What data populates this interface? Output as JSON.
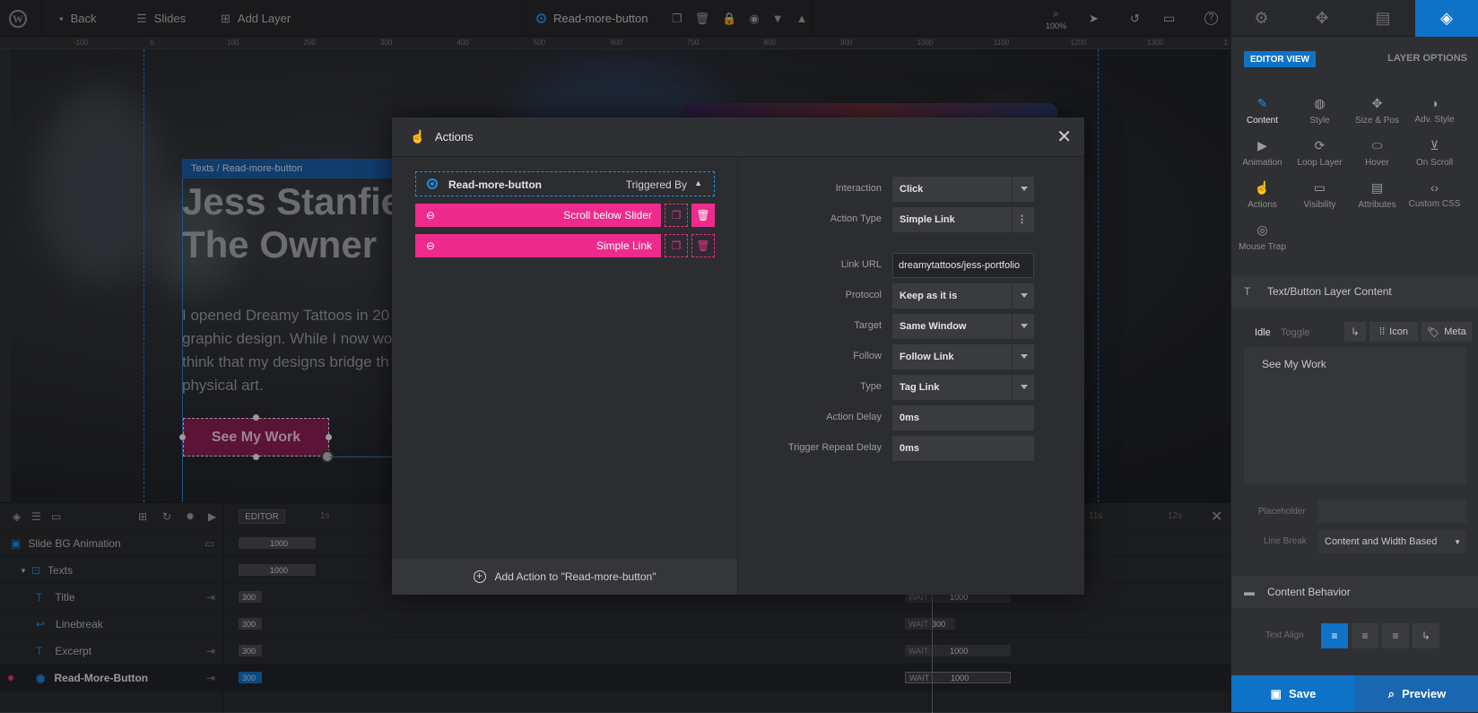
{
  "topbar": {
    "back": "Back",
    "slides": "Slides",
    "add_layer": "Add Layer",
    "layer_name": "Read-more-button",
    "zoom": "100%"
  },
  "ruler": {
    "ticks": [
      "-100",
      "0",
      "100",
      "200",
      "300",
      "400",
      "500",
      "600",
      "700",
      "800",
      "900",
      "1000",
      "1100",
      "1200",
      "1300",
      "1"
    ]
  },
  "canvas": {
    "breadcrumb": "Texts / Read-more-button",
    "title_line1": "Jess Stanfie",
    "title_line2": "The Owner ",
    "excerpt_line1": "I opened Dreamy Tattoos in 20",
    "excerpt_line2": "graphic design. While I now wo",
    "excerpt_line3": "think that my designs bridge th",
    "excerpt_line4": "physical art.",
    "button_label": "See My Work"
  },
  "modal": {
    "title": "Actions",
    "layer_label": "Read-more-button",
    "triggered_by": "Triggered By",
    "actions": [
      {
        "label": "Scroll below Slider"
      },
      {
        "label": "Simple Link"
      }
    ],
    "add_action": "Add Action to \"Read-more-button\"",
    "fields": {
      "interaction": {
        "label": "Interaction",
        "value": "Click"
      },
      "action_type": {
        "label": "Action Type",
        "value": "Simple Link"
      },
      "link_url": {
        "label": "Link URL",
        "value": "dreamytattoos/jess-portfolio"
      },
      "protocol": {
        "label": "Protocol",
        "value": "Keep as it is"
      },
      "target": {
        "label": "Target",
        "value": "Same Window"
      },
      "follow": {
        "label": "Follow",
        "value": "Follow Link"
      },
      "type": {
        "label": "Type",
        "value": "Tag Link"
      },
      "action_delay": {
        "label": "Action Delay",
        "value": "0ms"
      },
      "trigger_repeat_delay": {
        "label": "Trigger Repeat Delay",
        "value": "0ms"
      }
    }
  },
  "timeline": {
    "editor_label": "EDITOR",
    "time_labels": {
      "t1": "1s",
      "t11": "11s",
      "t12": "12s"
    },
    "rows": [
      {
        "name": "Slide BG Animation",
        "bar": "1000"
      },
      {
        "name": "Texts",
        "bar": "1000"
      },
      {
        "name": "Title",
        "bar": "300",
        "wait": "WAIT",
        "end": "1000"
      },
      {
        "name": "Linebreak",
        "bar": "300",
        "wait": "WAIT",
        "end": "300"
      },
      {
        "name": "Excerpt",
        "bar": "300",
        "wait": "WAIT",
        "end": "1000"
      },
      {
        "name": "Read-More-Button",
        "bar": "300",
        "wait": "WAIT",
        "end": "1000"
      }
    ]
  },
  "sidebar": {
    "editor_view": "EDITOR VIEW",
    "layer_options": "LAYER OPTIONS",
    "tools": [
      {
        "label": "Content"
      },
      {
        "label": "Style"
      },
      {
        "label": "Size & Pos"
      },
      {
        "label": "Adv. Style"
      },
      {
        "label": "Animation"
      },
      {
        "label": "Loop Layer"
      },
      {
        "label": "Hover"
      },
      {
        "label": "On Scroll"
      },
      {
        "label": "Actions"
      },
      {
        "label": "Visibility"
      },
      {
        "label": "Attributes"
      },
      {
        "label": "Custom CSS"
      },
      {
        "label": "Mouse Trap"
      }
    ],
    "section_content": "Text/Button Layer Content",
    "idle": "Idle",
    "toggle": "Toggle",
    "icon": "Icon",
    "meta": "Meta",
    "content_text": "See My Work",
    "placeholder_label": "Placeholder",
    "line_break_label": "Line Break",
    "line_break_value": "Content and Width Based",
    "section_behavior": "Content Behavior",
    "text_align_label": "Text Align",
    "save": "Save",
    "preview": "Preview"
  },
  "colors": {
    "accent": "#0e72c7",
    "pink": "#ee2b8c",
    "button_bg": "#8c1e54"
  }
}
